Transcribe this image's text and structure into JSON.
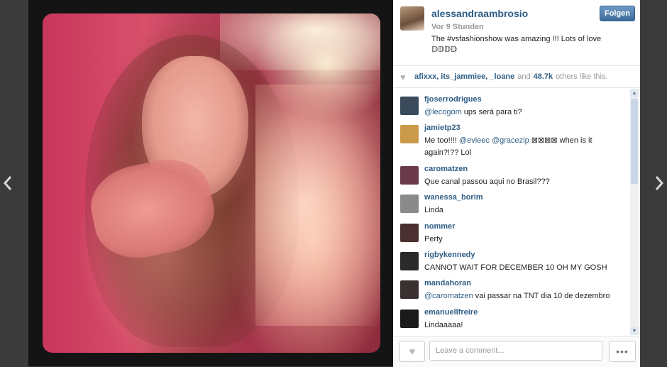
{
  "post": {
    "username": "alessandraambrosio",
    "time": "Vor 9 Stunden",
    "caption": "The #vsfashionshow was amazing !!! Lots of love 𝔻𝔻𝔻𝔻",
    "follow_label": "Folgen"
  },
  "likes": {
    "names": "afixxx, its_jammiee, _loane",
    "connector": "and",
    "count": "48.7k",
    "tail": "others like this."
  },
  "comments": [
    {
      "user": "fjoserrodrigues",
      "mention": "@lecogom",
      "text": " ups será para ti?",
      "avatar_color": "#3a4a5a"
    },
    {
      "user": "jamietp23",
      "pre": "Me too!!!! ",
      "mention": "@evieec @gracezip",
      "text": " ⊠⊠⊠⊠ when is it again?!?? Lol",
      "avatar_color": "#c89a4a"
    },
    {
      "user": "caromatzen",
      "text": "Que canal passou aqui no Brasil???",
      "avatar_color": "#6a3a4a"
    },
    {
      "user": "wanessa_borim",
      "text": "Linda",
      "avatar_color": "#8a8a8a"
    },
    {
      "user": "nommer",
      "text": "Perty",
      "avatar_color": "#4a3030"
    },
    {
      "user": "rigbykennedy",
      "text": "CANNOT WAIT FOR DECEMBER 10 OH MY GOSH",
      "avatar_color": "#2a2a2a"
    },
    {
      "user": "mandahoran",
      "mention": "@caromatzen",
      "text": " vai passar na TNT dia 10 de dezembro",
      "avatar_color": "#3a3030"
    },
    {
      "user": "emanuellfreire",
      "text": "Lindaaaaa!",
      "avatar_color": "#1a1a1a"
    }
  ],
  "footer": {
    "comment_placeholder": "Leave a comment...",
    "more_label": "•••"
  },
  "colors": {
    "link": "#2e5e86",
    "follow_button": "#4a78a6",
    "page_background": "#3b3b3b"
  },
  "icons": {
    "prev": "chevron-left-icon",
    "next": "chevron-right-icon",
    "like": "heart-icon",
    "more": "ellipsis-icon"
  }
}
